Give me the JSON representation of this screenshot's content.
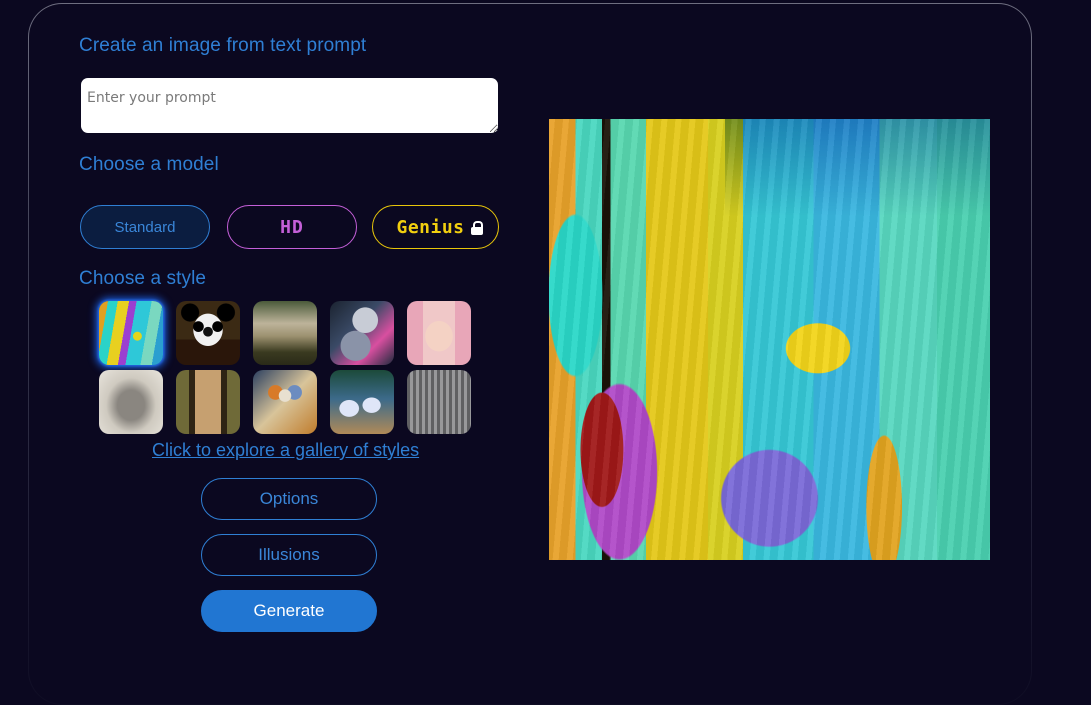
{
  "headings": {
    "create": "Create an image from text prompt",
    "model": "Choose a model",
    "style": "Choose a style"
  },
  "prompt": {
    "value": "",
    "placeholder": "Enter your prompt"
  },
  "models": {
    "standard": "Standard",
    "hd": "HD",
    "genius": "Genius",
    "genius_icon": "lock-icon",
    "selected": "Standard"
  },
  "styles": [
    {
      "name": "abstract-painting",
      "selected": true
    },
    {
      "name": "panda"
    },
    {
      "name": "misty-landscape"
    },
    {
      "name": "cyberpunk-robot"
    },
    {
      "name": "anime-girl"
    },
    {
      "name": "vintage-car-sketch"
    },
    {
      "name": "renaissance-portrait"
    },
    {
      "name": "flower-vase"
    },
    {
      "name": "ballet-dancers"
    },
    {
      "name": "city-etching"
    }
  ],
  "gallery_link": "Click to explore a gallery of styles",
  "buttons": {
    "options": "Options",
    "illusions": "Illusions",
    "generate": "Generate"
  },
  "colors": {
    "accent": "#2f7fd4",
    "hd": "#c45fd8",
    "genius": "#f2cf0f",
    "background": "#0b0820"
  }
}
